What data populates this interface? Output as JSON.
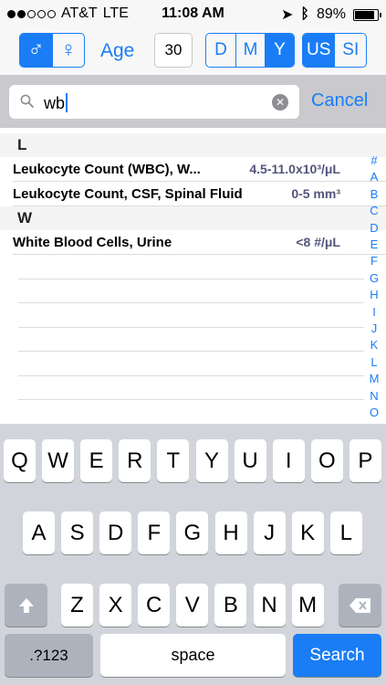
{
  "status": {
    "carrier": "AT&T",
    "network": "LTE",
    "time": "11:08 AM",
    "battery": "89%",
    "battery_level": 0.89,
    "signal_bars": 2
  },
  "toolbar": {
    "male_symbol": "♂",
    "female_symbol": "♀",
    "age_label": "Age",
    "age_value": "30",
    "age_units": [
      "D",
      "M",
      "Y"
    ],
    "unit_systems": [
      "US",
      "SI"
    ]
  },
  "search": {
    "query": "wb",
    "cancel_label": "Cancel"
  },
  "sections": [
    {
      "header": "L",
      "rows": [
        {
          "name": "Leukocyte Count (WBC), W...",
          "range": "4.5-11.0x10³/μL"
        },
        {
          "name": "Leukocyte Count, CSF, Spinal Fluid",
          "range": "0-5 mm³"
        }
      ]
    },
    {
      "header": "W",
      "rows": [
        {
          "name": "White Blood Cells, Urine",
          "range": "<8 #/μL"
        }
      ]
    }
  ],
  "index_letters": [
    "#",
    "A",
    "B",
    "C",
    "D",
    "E",
    "F",
    "G",
    "H",
    "I",
    "J",
    "K",
    "L",
    "M",
    "N",
    "O"
  ],
  "keyboard": {
    "row1": [
      "Q",
      "W",
      "E",
      "R",
      "T",
      "Y",
      "U",
      "I",
      "O",
      "P"
    ],
    "row2": [
      "A",
      "S",
      "D",
      "F",
      "G",
      "H",
      "J",
      "K",
      "L"
    ],
    "row3": [
      "Z",
      "X",
      "C",
      "V",
      "B",
      "N",
      "M"
    ],
    "numbers_label": ".?123",
    "space_label": "space",
    "search_label": "Search"
  },
  "colors": {
    "accent": "#1a7df5",
    "range_text": "#54557a"
  }
}
